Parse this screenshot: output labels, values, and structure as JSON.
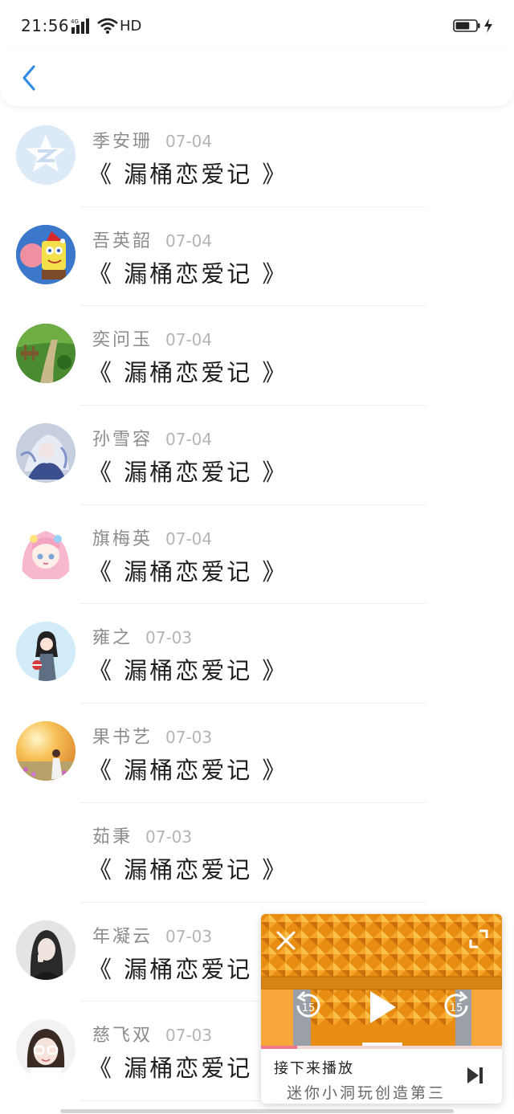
{
  "status_bar": {
    "time": "21:56",
    "network": "4G",
    "hd": "HD",
    "battery_level": 0.7
  },
  "header": {
    "back_icon": "chevron-left-icon",
    "accent": "#2f8de4"
  },
  "rows": [
    {
      "name": "季安珊",
      "date": "07-04",
      "title": "《 漏桶恋爱记 》",
      "avatar": "qzone-logo"
    },
    {
      "name": "吾英韶",
      "date": "07-04",
      "title": "《 漏桶恋爱记 》",
      "avatar": "cartoon-sponge"
    },
    {
      "name": "奕问玉",
      "date": "07-04",
      "title": "《 漏桶恋爱记 》",
      "avatar": "garden-path"
    },
    {
      "name": "孙雪容",
      "date": "07-04",
      "title": "《 漏桶恋爱记 》",
      "avatar": "anime-blue"
    },
    {
      "name": "旗梅英",
      "date": "07-04",
      "title": "《 漏桶恋爱记 》",
      "avatar": "anime-pink"
    },
    {
      "name": "雍之",
      "date": "07-03",
      "title": "《 漏桶恋爱记 》",
      "avatar": "girl-illustration"
    },
    {
      "name": "果书艺",
      "date": "07-03",
      "title": "《 漏桶恋爱记 》",
      "avatar": "sunset-field"
    },
    {
      "name": "茹秉",
      "date": "07-03",
      "title": "《 漏桶恋爱记 》",
      "avatar": "none"
    },
    {
      "name": "年凝云",
      "date": "07-03",
      "title": "《 漏桶恋爱记 》",
      "avatar": "photo-portrait"
    },
    {
      "name": "慈飞双",
      "date": "07-03",
      "title": "《 漏桶恋爱记 》",
      "avatar": "girl-glasses"
    }
  ],
  "mini_player": {
    "up_next_label": "接下来播放",
    "next_title": "迷你小洞玩创造第三",
    "progress": 0.15,
    "rewind_label": "15",
    "forward_label": "15",
    "icons": [
      "close-icon",
      "fullscreen-icon",
      "rewind-15-icon",
      "play-icon",
      "forward-15-icon",
      "skip-next-icon"
    ]
  }
}
